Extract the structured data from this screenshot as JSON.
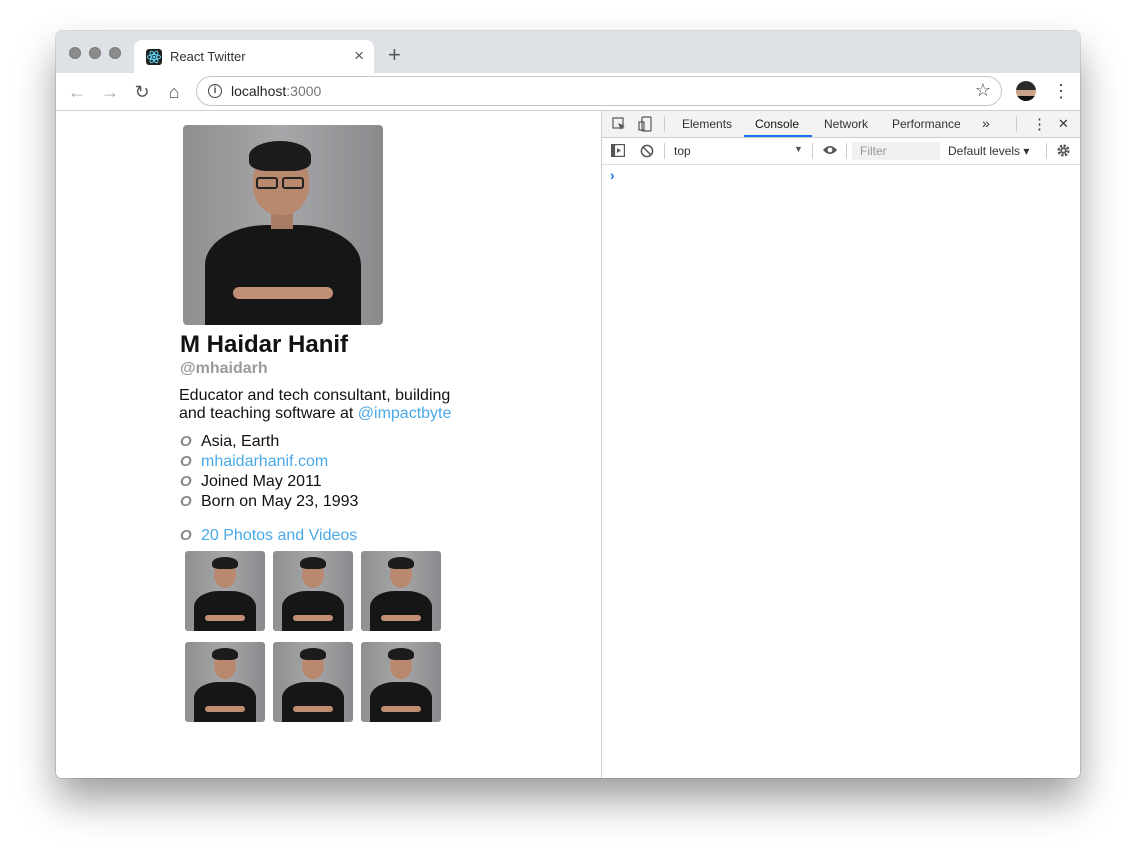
{
  "browser": {
    "tab_title": "React Twitter",
    "tab_close": "×",
    "new_tab": "+",
    "url_host": "localhost",
    "url_port": ":3000",
    "back": "←",
    "forward": "→",
    "reload": "↻",
    "home": "⌂",
    "bookmark": "☆",
    "menu": "⋮"
  },
  "profile": {
    "name": "M Haidar Hanif",
    "handle": "@mhaidarh",
    "bio_text": "Educator and tech consultant, building and teaching software at ",
    "bio_link": "@impactbyte",
    "meta_icon": "O",
    "location": "Asia, Earth",
    "website": "mhaidarhanif.com",
    "joined": "Joined May 2011",
    "born": "Born on May 23, 1993",
    "photos_link": "20 Photos and Videos",
    "thumb_count": 6
  },
  "devtools": {
    "tabs": [
      "Elements",
      "Console",
      "Network",
      "Performance"
    ],
    "active_tab": "Console",
    "more": "»",
    "close": "✕",
    "kebab": "⋮",
    "context": "top",
    "filter_placeholder": "Filter",
    "levels": "Default levels ▾",
    "prompt": "›"
  },
  "colors": {
    "link": "#4aa9e8",
    "accent": "#1a73e8"
  }
}
